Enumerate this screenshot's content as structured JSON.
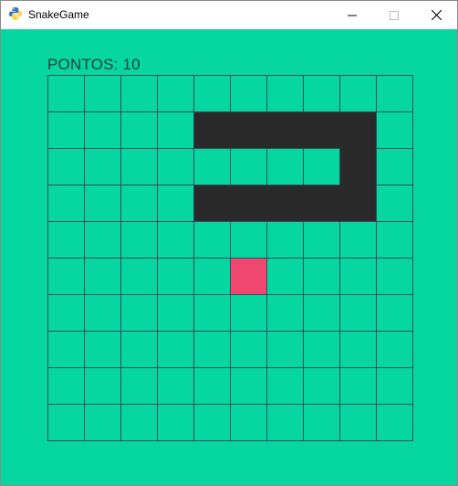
{
  "window": {
    "title": "SnakeGame",
    "app_icon": "python-icon",
    "controls": [
      "minimize-icon",
      "maximize-icon",
      "close-icon"
    ]
  },
  "game": {
    "score_label": "PONTOS: 10",
    "grid": {
      "cols": 10,
      "rows": 10
    },
    "snake": [
      [
        4,
        1
      ],
      [
        5,
        1
      ],
      [
        6,
        1
      ],
      [
        7,
        1
      ],
      [
        8,
        1
      ],
      [
        8,
        2
      ],
      [
        8,
        3
      ],
      [
        7,
        3
      ],
      [
        6,
        3
      ],
      [
        5,
        3
      ],
      [
        4,
        3
      ]
    ],
    "food": [
      5,
      5
    ],
    "colors": {
      "background": "#06d6a0",
      "grid_line": "#2f4f5a",
      "snake": "#292929",
      "food": "#ef476f",
      "score_text": "#1f3f3a"
    }
  }
}
